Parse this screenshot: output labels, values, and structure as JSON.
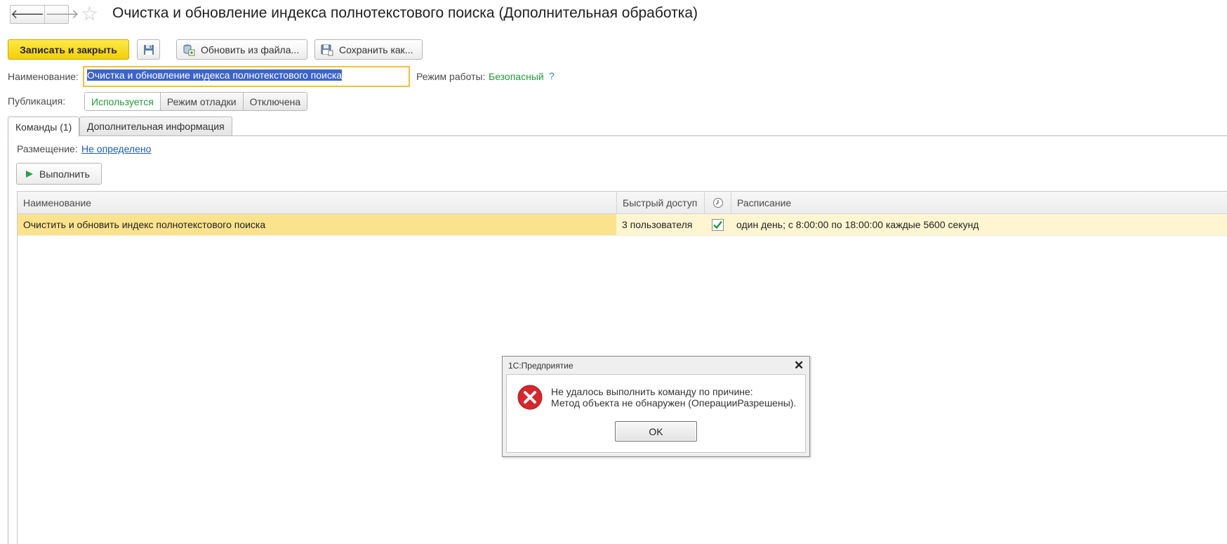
{
  "header": {
    "back_icon": "arrow-left-icon",
    "forward_icon": "arrow-right-icon",
    "favorite_icon": "star-icon",
    "title": "Очистка и обновление индекса полнотекстового поиска (Дополнительная обработка)"
  },
  "toolbar": {
    "save_close_label": "Записать и закрыть",
    "save_icon": "floppy-disk-icon",
    "load_from_file_label": "Обновить из файла...",
    "save_as_label": "Сохранить как..."
  },
  "form": {
    "name_label": "Наименование:",
    "name_value": "Очистка и обновление индекса полнотекстового поиска",
    "mode_label": "Режим работы:",
    "mode_value": "Безопасный",
    "mode_help": "?",
    "publication_label": "Публикация:",
    "publication_options": [
      "Используется",
      "Режим отладки",
      "Отключена"
    ],
    "publication_selected": "Используется"
  },
  "tabs": [
    "Команды (1)",
    "Дополнительная информация"
  ],
  "commands": {
    "placement_label": "Размещение:",
    "placement_value": "Не определено",
    "run_label": "Выполнить",
    "columns": [
      "Наименование",
      "Быстрый доступ",
      "",
      "Расписание"
    ],
    "schedule_column_icon": "clock-icon",
    "rows": [
      {
        "name": "Очистить и обновить индекс полнотекстового поиска",
        "quick_access": "3 пользователя",
        "scheduled": true,
        "schedule": "один день; с 8:00:00 по 18:00:00 каждые 5600 секунд"
      }
    ]
  },
  "dialog": {
    "title": "1С:Предприятие",
    "message_line1": "Не удалось выполнить команду по причине:",
    "message_line2": "Метод объекта не обнаружен (ОперацииРазрешены).",
    "ok_label": "OK",
    "icon": "error-icon"
  },
  "colors": {
    "primary_button": "#f4d000",
    "selected_row": "#fbe38e",
    "row_highlight": "#fff6d1",
    "link": "#1b5fb5",
    "green_text": "#1f9a3a",
    "error": "#d9262c"
  }
}
